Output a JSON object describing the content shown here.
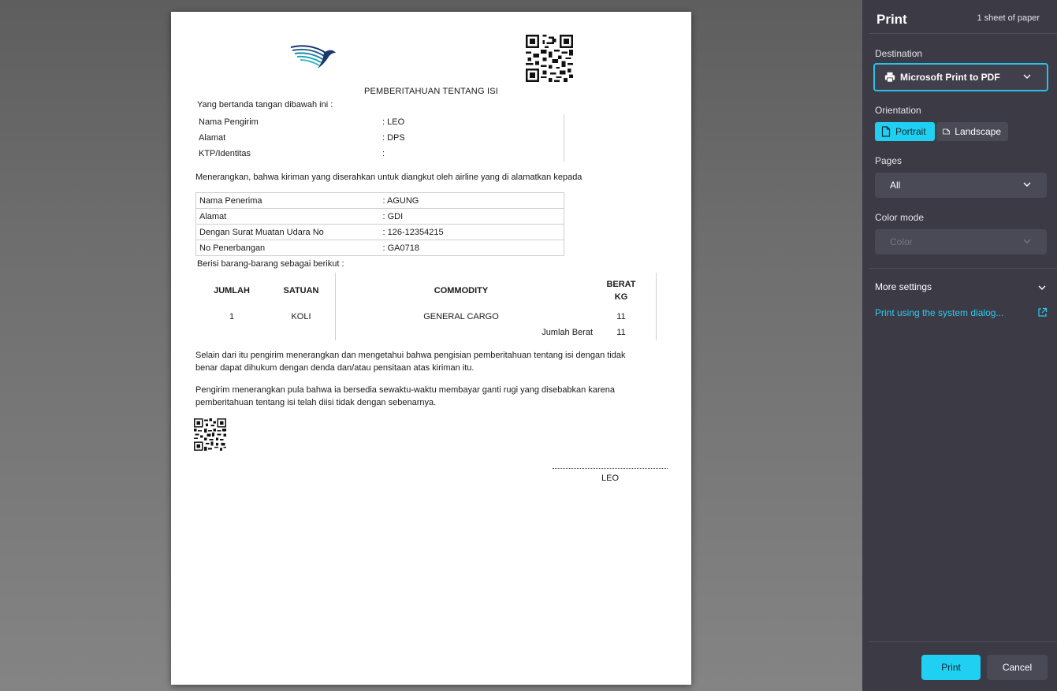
{
  "document": {
    "title": "PEMBERITAHUAN TENTANG ISI",
    "intro": "Yang bertanda tangan dibawah ini :",
    "sender": [
      {
        "label": "Nama Pengirim",
        "value": ": LEO"
      },
      {
        "label": "Alamat",
        "value": ": DPS"
      },
      {
        "label": "KTP/Identitas",
        "value": ":"
      }
    ],
    "statement": "Menerangkan, bahwa kiriman yang diserahkan untuk diangkut oleh airline yang di alamatkan kepada",
    "recipient": [
      {
        "label": "Nama Penerima",
        "value": ": AGUNG"
      },
      {
        "label": "Alamat",
        "value": ": GDI"
      },
      {
        "label": "Dengan Surat Muatan Udara No",
        "value": ": 126-12354215"
      },
      {
        "label": "No Penerbangan",
        "value": ": GA0718"
      }
    ],
    "goods_intro": "Berisi barang-barang sebagai berikut :",
    "goods_headers": {
      "jumlah": "JUMLAH",
      "satuan": "SATUAN",
      "commodity": "COMMODITY",
      "berat_line1": "BERAT",
      "berat_line2": "KG"
    },
    "goods_row": {
      "jumlah": "1",
      "satuan": "KOLI",
      "commodity": "GENERAL CARGO",
      "berat": "11"
    },
    "total": {
      "label": "Jumlah Berat",
      "value": "11"
    },
    "para1_line1": "Selain dari itu pengirim menerangkan dan mengetahui bahwa pengisian pemberitahuan tentang isi dengan tidak",
    "para1_line2": "benar dapat dihukum dengan denda dan/atau pensitaan atas kiriman itu.",
    "para2_line1": "Pengirim menerangkan pula bahwa ia bersedia sewaktu-waktu membayar ganti rugi yang disebabkan karena",
    "para2_line2": "pemberitahuan tentang isi telah diisi tidak dengan sebenarnya.",
    "signature_name": "LEO"
  },
  "print_panel": {
    "title": "Print",
    "sheets": "1 sheet of paper",
    "destination_label": "Destination",
    "destination_value": "Microsoft Print to PDF",
    "orientation_label": "Orientation",
    "portrait": "Portrait",
    "landscape": "Landscape",
    "pages_label": "Pages",
    "pages_value": "All",
    "color_mode_label": "Color mode",
    "color_mode_value": "Color",
    "more_settings": "More settings",
    "system_dialog": "Print using the system dialog...",
    "print_button": "Print",
    "cancel_button": "Cancel",
    "accent_color": "#1fd0f2",
    "panel_bg": "#3b3a45"
  }
}
